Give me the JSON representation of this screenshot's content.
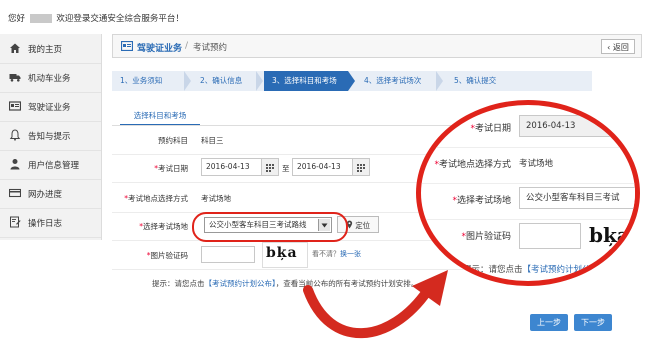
{
  "top": {
    "greeting_prefix": "您好",
    "greeting_suffix": "欢迎登录交通安全综合服务平台！"
  },
  "sidebar": {
    "items": [
      {
        "label": "我的主页",
        "icon": "home-icon"
      },
      {
        "label": "机动车业务",
        "icon": "truck-icon"
      },
      {
        "label": "驾驶证业务",
        "icon": "id-card-icon"
      },
      {
        "label": "告知与提示",
        "icon": "bell-icon"
      },
      {
        "label": "用户信息管理",
        "icon": "user-icon"
      },
      {
        "label": "网办进度",
        "icon": "card-icon"
      },
      {
        "label": "操作日志",
        "icon": "log-icon"
      }
    ]
  },
  "header": {
    "title": "驾驶证业务",
    "separator": "/",
    "subtitle": "考试预约",
    "back_label": "返回"
  },
  "steps": [
    {
      "label": "1、业务须知"
    },
    {
      "label": "2、确认信息"
    },
    {
      "label": "3、选择科目和考场"
    },
    {
      "label": "4、选择考试场次"
    },
    {
      "label": "5、确认提交"
    }
  ],
  "form": {
    "subtab": "选择科目和考场",
    "subject_label": "预约科目",
    "subject_value": "科目三",
    "date_label": "考试日期",
    "date_from": "2016-04-13",
    "date_to_sep": "至",
    "date_to": "2016-04-13",
    "site_mode_label": "考试地点选择方式",
    "site_mode_value": "考试场地",
    "site_label": "选择考试场地",
    "site_value": "公交小型客车科目三考试路线",
    "locate_label": "定位",
    "captcha_label": "图片验证码",
    "captcha_text": "bķa",
    "refresh_text": "看不清？",
    "refresh_link": "换一张",
    "hint_prefix": "提示：请您点击",
    "hint_link": "【考试预约计划公布】",
    "hint_suffix": "，查看当前公布的所有考试预约计划安排。",
    "required_mark": "*"
  },
  "buttons": {
    "prev": "上一步",
    "next": "下一步"
  },
  "zoom": {
    "date_label": "考试日期",
    "date_value": "2016-04-13",
    "mode_label": "考试地点选择方式",
    "mode_value": "考试场地",
    "site_label": "选择考试场地",
    "site_value": "公交小型客车科目三考试",
    "captcha_label": "图片验证码",
    "hint_prefix": "提示：请您点击",
    "hint_link": "【考试预约计划公"
  },
  "colors": {
    "accent": "#2a6bb5",
    "highlight": "#e0231a",
    "button": "#3d86d0"
  }
}
